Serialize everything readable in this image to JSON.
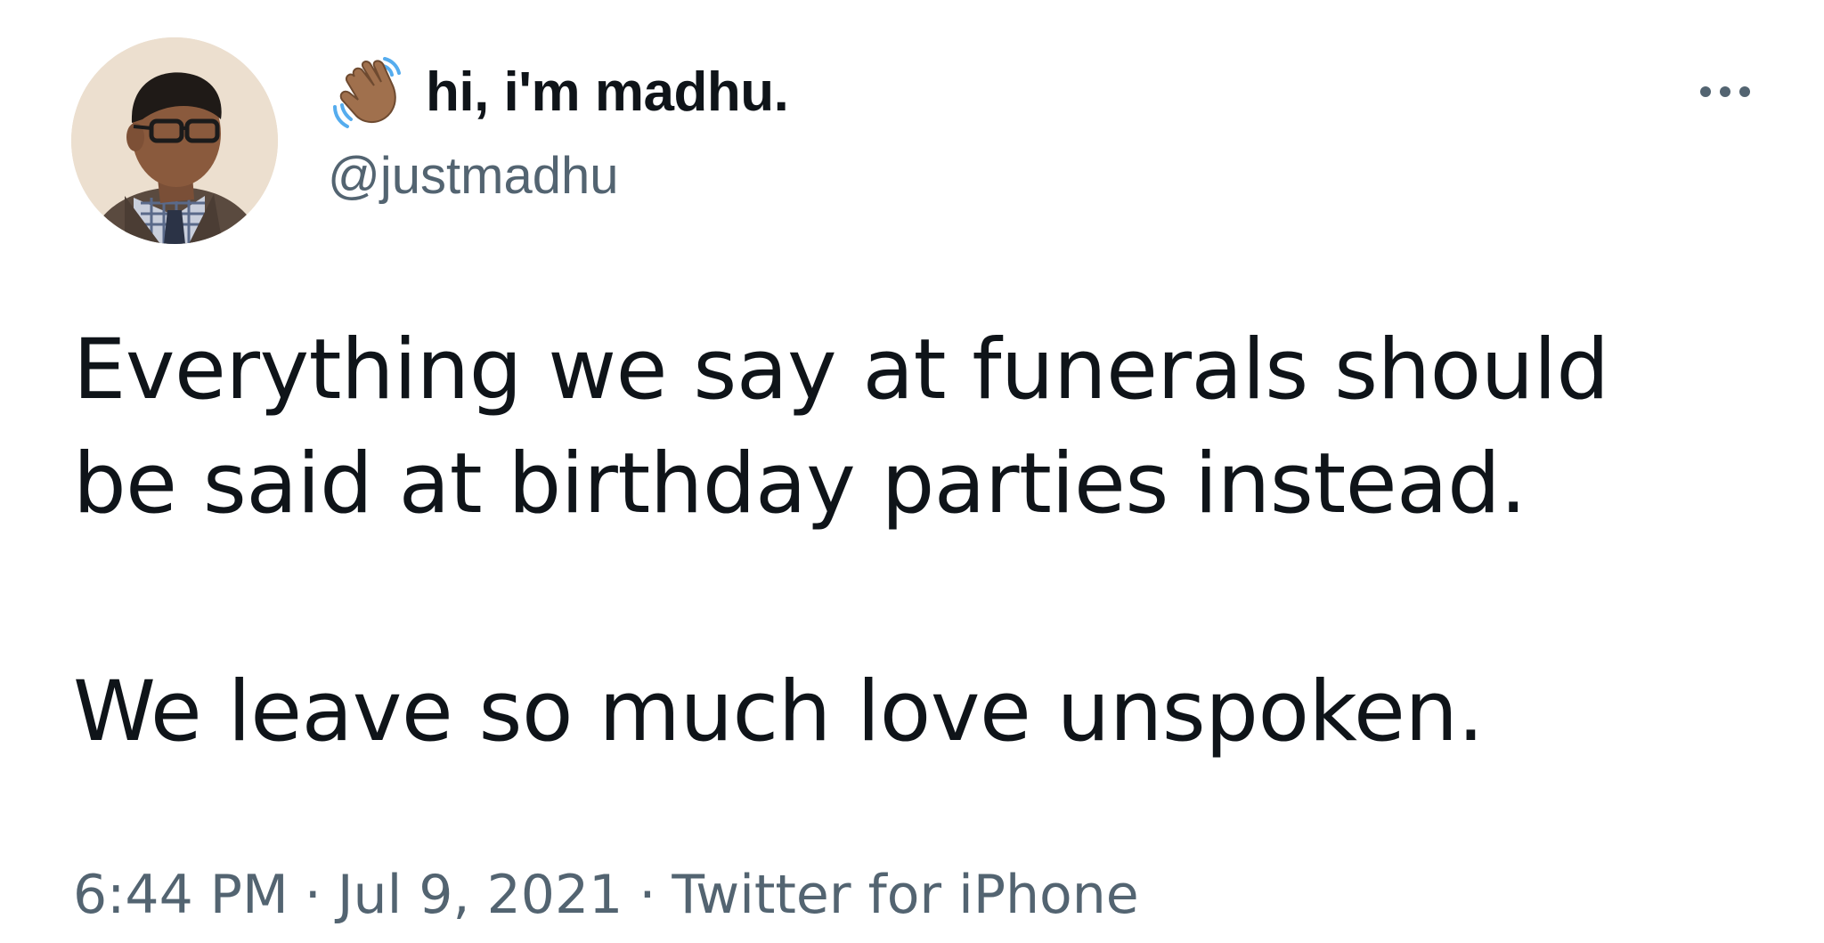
{
  "author": {
    "display_name": "hi, i'm madhu.",
    "handle": "@justmadhu"
  },
  "tweet": {
    "paragraphs": [
      "Everything we say at funerals should",
      "be said at birthday parties instead.",
      "We leave so much love unspoken."
    ]
  },
  "meta": {
    "time": "6:44 PM",
    "separator": "·",
    "date": "Jul 9, 2021",
    "source": "Twitter for iPhone"
  },
  "icons": {
    "name_emoji": "waving-hand-icon",
    "menu": "more-horizontal-icon"
  },
  "colors": {
    "text_primary": "#0f1419",
    "text_secondary": "#536471",
    "background": "#ffffff"
  }
}
